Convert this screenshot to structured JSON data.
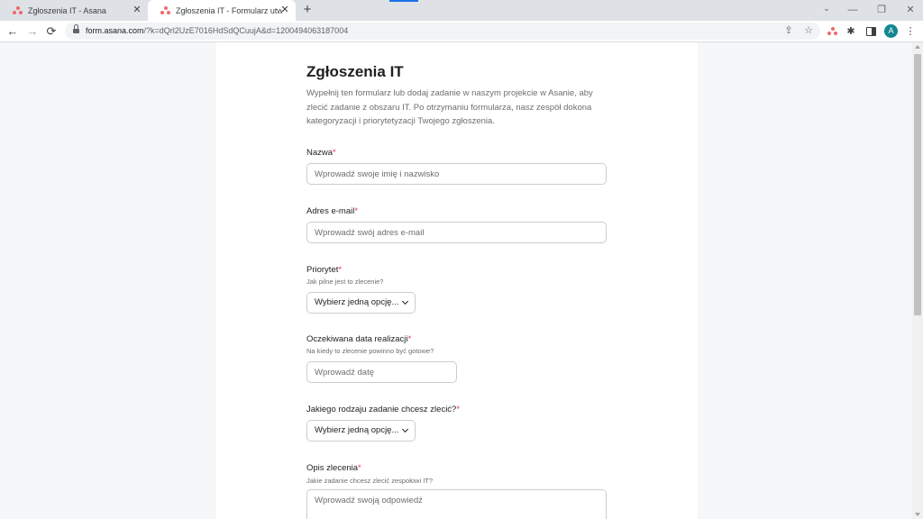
{
  "browser": {
    "tabs": [
      {
        "title": "Zgłoszenia IT - Asana",
        "close_glyph": "✕"
      },
      {
        "title": "Zgłoszenia IT - Formularz utworzony",
        "close_glyph": "✕"
      }
    ],
    "new_tab_glyph": "+",
    "window_controls": {
      "tab_search": "⌄",
      "minimize": "—",
      "restore": "❐",
      "close": "✕"
    },
    "toolbar": {
      "back": "←",
      "forward": "→",
      "reload": "⟳",
      "url_host": "form.asana.com",
      "url_rest": "/?k=dQrl2UzE7016HdSdQCuujA&d=1200494063187004",
      "share_glyph": "⇪",
      "star_glyph": "☆",
      "extensions_glyph": "✱",
      "menu_glyph": "⋮",
      "avatar_letter": "A"
    },
    "accent_color": "#f06a6a"
  },
  "form": {
    "title": "Zgłoszenia IT",
    "description": "Wypełnij ten formularz lub dodaj zadanie w naszym projekcie w Asanie, aby zlecić zadanie z obszaru IT. Po otrzymaniu formularza, nasz zespół dokona kategoryzacji i priorytetyzacji Twojego zgłoszenia.",
    "required_marker": "*",
    "fields": {
      "name": {
        "label": "Nazwa",
        "placeholder": "Wprowadź swoje imię i nazwisko"
      },
      "email": {
        "label": "Adres e-mail",
        "placeholder": "Wprowadź swój adres e-mail"
      },
      "priority": {
        "label": "Priorytet",
        "help": "Jak pilne jest to zlecenie?",
        "selected": "Wybierz jedną opcję..."
      },
      "due_date": {
        "label": "Oczekiwana data realizacji",
        "help": "Na kiedy to zlecenie powinno być gotowe?",
        "placeholder": "Wprowadź datę"
      },
      "task_type": {
        "label": "Jakiego rodzaju zadanie chcesz zlecić?",
        "selected": "Wybierz jedną opcję..."
      },
      "description": {
        "label": "Opis zlecenia",
        "help": "Jakie zadanie chcesz zlecić zespołowi IT?",
        "placeholder": "Wprowadź swoją odpowiedź"
      }
    }
  }
}
